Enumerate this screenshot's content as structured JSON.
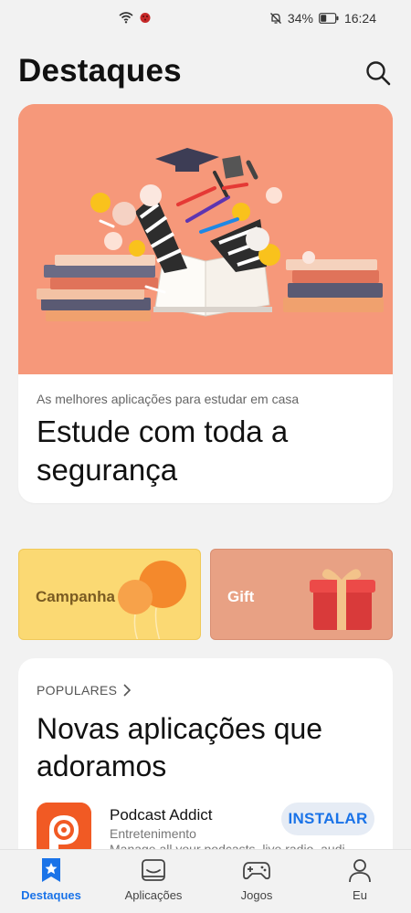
{
  "status_bar": {
    "battery": "34%",
    "time": "16:24",
    "icons": [
      "wifi-icon",
      "notification-icon",
      "mute-icon",
      "battery-icon"
    ]
  },
  "header": {
    "title": "Destaques",
    "search_icon": "search-icon"
  },
  "hero": {
    "subtitle": "As melhores aplicações para estudar em casa",
    "title": "Estude com toda a segurança",
    "image_color": "#f6987a"
  },
  "promos": [
    {
      "label": "Campanha",
      "color": "#fbd973"
    },
    {
      "label": "Gift",
      "color": "#e8a184"
    }
  ],
  "populares": {
    "kicker": "POPULARES",
    "title": "Novas aplicações que adoramos",
    "app": {
      "name": "Podcast Addict",
      "category": "Entretenimento",
      "description": "Manage all your podcasts, live radio, audi",
      "install_label": "INSTALAR",
      "icon_color": "#f15a24"
    }
  },
  "bottom_nav": {
    "active_color": "#1a73e8",
    "items": [
      {
        "label": "Destaques",
        "icon": "star-icon"
      },
      {
        "label": "Aplicações",
        "icon": "apps-icon"
      },
      {
        "label": "Jogos",
        "icon": "gamepad-icon"
      },
      {
        "label": "Eu",
        "icon": "person-icon"
      }
    ]
  }
}
